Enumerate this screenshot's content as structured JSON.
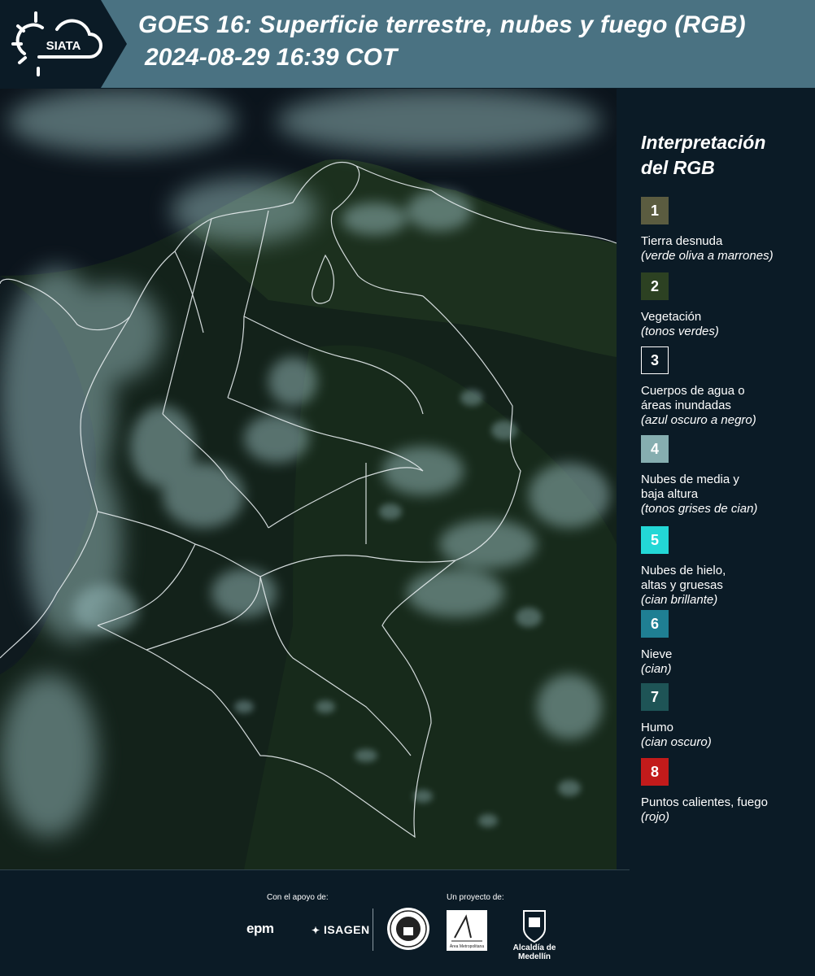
{
  "header": {
    "logo_text": "SIATA",
    "title_line1": "GOES 16: Superficie terrestre, nubes y fuego (RGB)",
    "title_line2": "2024-08-29 16:39 COT"
  },
  "legend": {
    "title_line1": "Interpretación",
    "title_line2": "del RGB",
    "items": [
      {
        "number": "1",
        "color": "#5b5c40",
        "lines": [
          "Tierra desnuda"
        ],
        "note": "(verde oliva a marrones)"
      },
      {
        "number": "2",
        "color": "#2c4122",
        "lines": [
          "Vegetación"
        ],
        "note": "(tonos verdes)"
      },
      {
        "number": "3",
        "color": "#0b1b26",
        "lines": [
          "Cuerpos de agua o",
          "áreas inundadas"
        ],
        "note": "(azul oscuro a negro)"
      },
      {
        "number": "4",
        "color": "#86aeb0",
        "lines": [
          "Nubes de media y",
          "baja altura"
        ],
        "note": "(tonos grises de cian)"
      },
      {
        "number": "5",
        "color": "#23d7d6",
        "lines": [
          "Nubes de hielo,",
          "altas y gruesas"
        ],
        "note": "(cian brillante)"
      },
      {
        "number": "6",
        "color": "#1f7f93",
        "lines": [
          "Nieve"
        ],
        "note": "(cian)"
      },
      {
        "number": "7",
        "color": "#1e5456",
        "lines": [
          "Humo"
        ],
        "note": "(cian oscuro)"
      },
      {
        "number": "8",
        "color": "#c21b1b",
        "lines": [
          "Puntos calientes, fuego"
        ],
        "note": "(rojo)"
      }
    ]
  },
  "footer": {
    "support_label": "Con el apoyo de:",
    "project_label": "Un proyecto de:",
    "sponsor1": "epm",
    "sponsor2": "ISAGEN",
    "partner_amva": "Área Metropolitana",
    "partner_medellin": "Alcaldía de Medellín"
  }
}
